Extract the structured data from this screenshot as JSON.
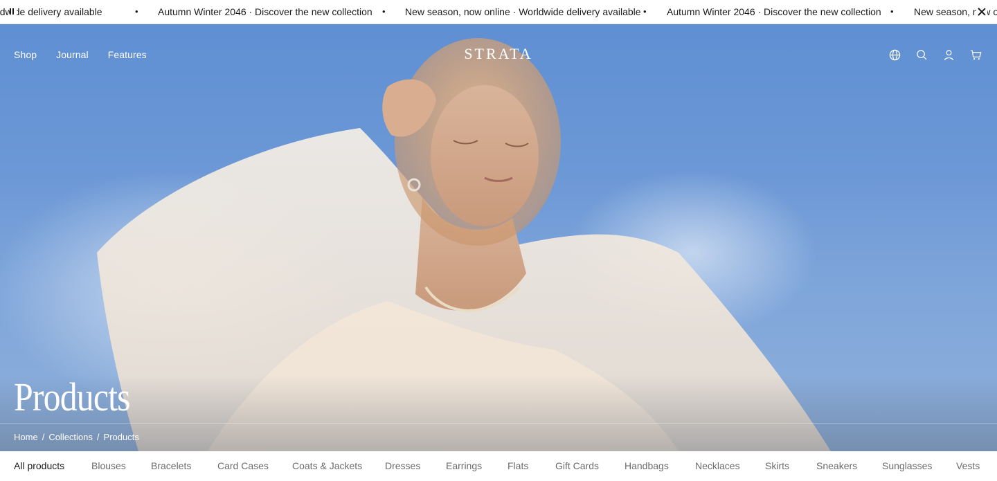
{
  "announcement": {
    "messages": [
      "New season, now online · Worldwide delivery available",
      "Autumn Winter 2046 · Discover the new collection",
      "New season, now online · Worldwide delivery available",
      "Autumn Winter 2046 · Discover the new collection",
      "New season, now online · Worldwide delivery available"
    ],
    "separator": "•"
  },
  "header": {
    "nav": [
      "Shop",
      "Journal",
      "Features"
    ],
    "logo": "STRATA",
    "icons": [
      "globe-icon",
      "search-icon",
      "account-icon",
      "cart-icon"
    ]
  },
  "hero": {
    "title": "Products",
    "breadcrumb": [
      "Home",
      "Collections",
      "Products"
    ],
    "breadcrumb_separator": "/"
  },
  "categories": {
    "active": "All products",
    "items": [
      "All products",
      "Blouses",
      "Bracelets",
      "Card Cases",
      "Coats & Jackets",
      "Dresses",
      "Earrings",
      "Flats",
      "Gift Cards",
      "Handbags",
      "Necklaces",
      "Skirts",
      "Sneakers",
      "Sunglasses",
      "Vests"
    ]
  },
  "colors": {
    "sky": "#6c98d6",
    "text": "#1a1a1a",
    "muted": "#6b6b6b"
  }
}
